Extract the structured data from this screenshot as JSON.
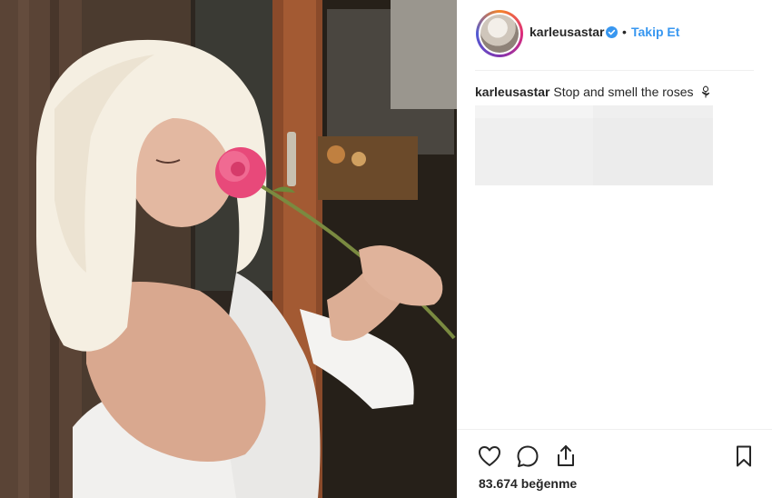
{
  "header": {
    "username": "karleusastar",
    "separator": "•",
    "follow_label": "Takip Et",
    "verified_icon": "verified-badge-icon",
    "accent_color": "#3897f0"
  },
  "caption": {
    "username": "karleusastar",
    "text": "Stop and smell the roses",
    "emoji_icon": "rose-icon"
  },
  "actions": {
    "like_icon": "heart-icon",
    "comment_icon": "comment-icon",
    "share_icon": "share-icon",
    "save_icon": "bookmark-icon"
  },
  "likes": {
    "label": "83.674 beğenme"
  },
  "photo": {
    "description_icon": "post-photo"
  }
}
